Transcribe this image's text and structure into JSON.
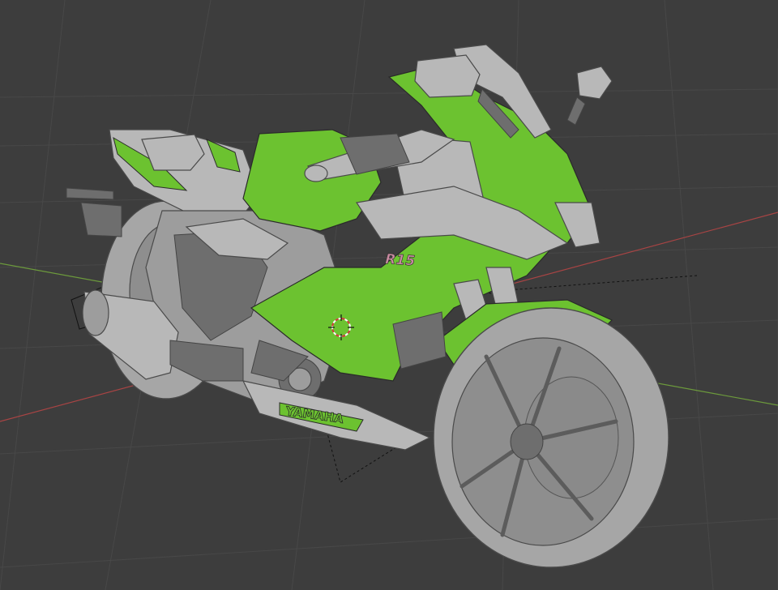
{
  "viewport": {
    "background": "#3d3d3d",
    "grid_color": "#484848",
    "x_axis_color": "#a84444",
    "y_axis_color": "#6c9a3c"
  },
  "model": {
    "accent_color": "#6cc230",
    "base_color": "#9d9d9d",
    "decals": {
      "brand": "YAMAHA",
      "model_badge": "R15"
    }
  },
  "icons": {
    "cursor": "3d-cursor-icon",
    "camera": "camera-object-icon"
  }
}
